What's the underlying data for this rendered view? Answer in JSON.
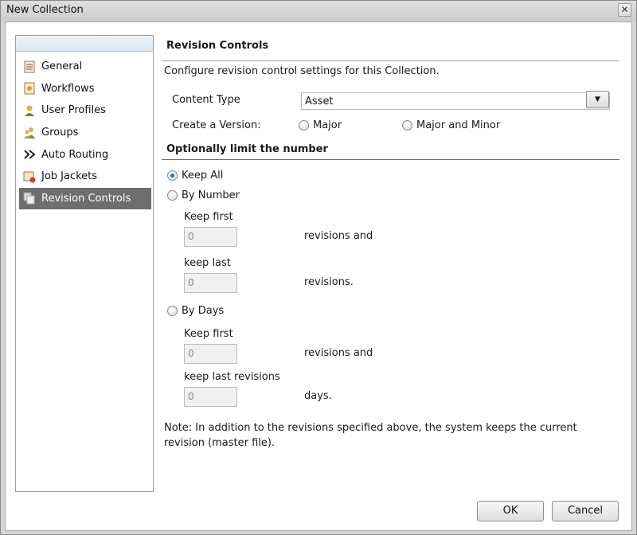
{
  "window": {
    "title": "New Collection",
    "close_glyph": "✕"
  },
  "sidebar": {
    "items": [
      {
        "label": "General",
        "icon": "general-icon"
      },
      {
        "label": "Workflows",
        "icon": "workflows-icon"
      },
      {
        "label": "User Profiles",
        "icon": "user-profiles-icon"
      },
      {
        "label": "Groups",
        "icon": "groups-icon"
      },
      {
        "label": "Auto Routing",
        "icon": "auto-routing-icon"
      },
      {
        "label": "Job Jackets",
        "icon": "job-jackets-icon"
      },
      {
        "label": "Revision Controls",
        "icon": "revision-controls-icon",
        "selected": true
      }
    ]
  },
  "content": {
    "title": "Revision Controls",
    "description": "Configure revision control settings for this Collection.",
    "content_type_label": "Content Type",
    "content_type_value": "Asset",
    "create_version_label": "Create a Version:",
    "version_options": [
      "Major",
      "Major and Minor"
    ],
    "limit_title": "Optionally limit the number",
    "limit_options": {
      "keep_all": "Keep All",
      "by_number": "By Number",
      "by_days": "By Days"
    },
    "selected_limit": "Keep All",
    "by_number": {
      "keep_first_label": "Keep first",
      "keep_first_value": "0",
      "keep_first_suffix": "revisions and",
      "keep_last_label": "keep last",
      "keep_last_value": "0",
      "keep_last_suffix": "revisions."
    },
    "by_days": {
      "keep_first_label": "Keep first",
      "keep_first_value": "0",
      "keep_first_suffix": "revisions and",
      "keep_last_label": "keep last revisions",
      "keep_last_value": "0",
      "keep_last_suffix": "days."
    },
    "note": "Note: In addition to the revisions specified above, the system keeps the current revision (master file)."
  },
  "buttons": {
    "ok": "OK",
    "cancel": "Cancel"
  },
  "colors": {
    "selected_nav_bg": "#6e6e6e",
    "sidebar_border": "#7aa7d6",
    "radio_check": "#2a6fbd"
  }
}
